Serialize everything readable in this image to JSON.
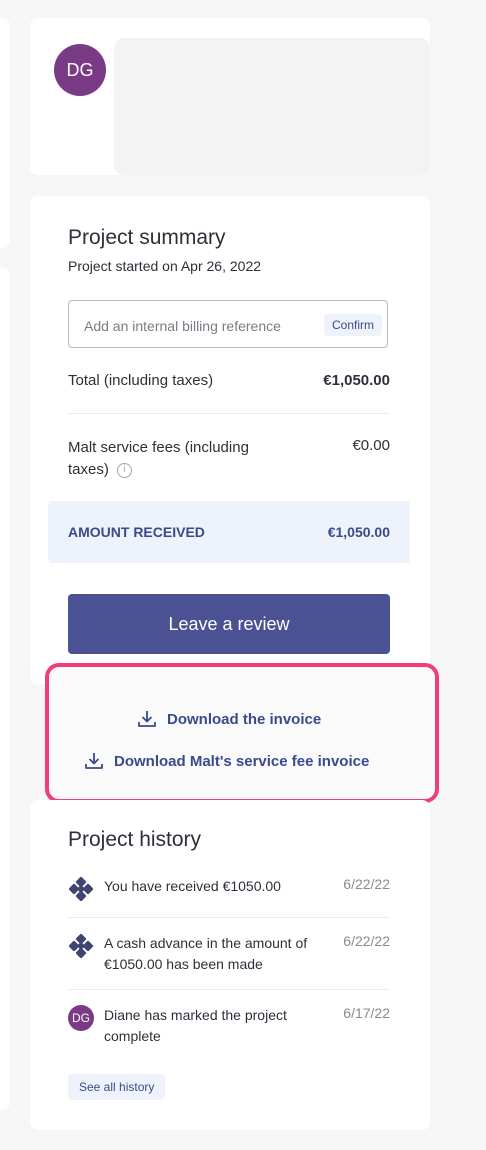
{
  "profile": {
    "initials": "DG"
  },
  "summary": {
    "title": "Project summary",
    "started": "Project started on Apr 26, 2022",
    "billing_placeholder": "Add an internal billing reference",
    "confirm_label": "Confirm",
    "total_label": "Total (including taxes)",
    "total_value": "€1,050.00",
    "fees_label_line1": "Malt service fees (including",
    "fees_label_line2": "taxes)",
    "fees_value": "€0.00",
    "info_glyph": "i",
    "amount_label": "AMOUNT RECEIVED",
    "amount_value": "€1,050.00",
    "review_label": "Leave a review"
  },
  "downloads": {
    "invoice_label": "Download the invoice",
    "fee_invoice_label": "Download Malt's service fee invoice",
    "icon": "download-icon",
    "highlight_color": "#f23e75"
  },
  "history": {
    "title": "Project history",
    "items": [
      {
        "text": "You have received €1050.00",
        "date": "6/22/22",
        "icon": "malt-logo-icon"
      },
      {
        "text": "A cash advance in the amount of €1050.00 has been made",
        "date": "6/22/22",
        "icon": "malt-logo-icon"
      },
      {
        "text": "Diane has marked the project complete",
        "date": "6/17/22",
        "initials": "DG"
      }
    ],
    "see_all_label": "See all history"
  },
  "colors": {
    "accent": "#4a5293",
    "avatar": "#7b3a86",
    "link": "#3b4a8c"
  }
}
